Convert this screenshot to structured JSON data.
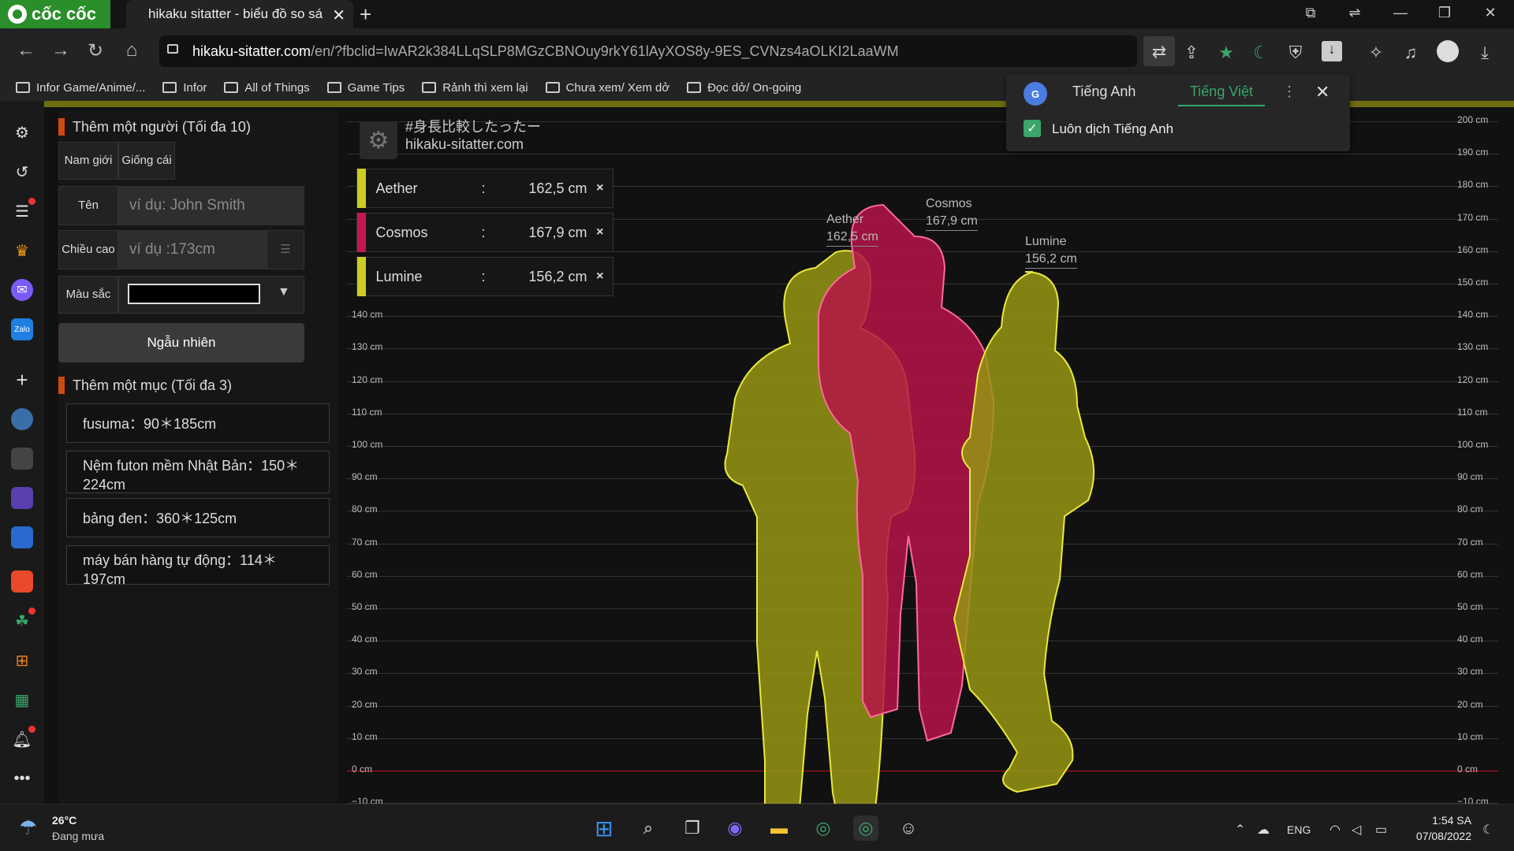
{
  "browser": {
    "brand": "cốc cốc",
    "tab_title": "hikaku sitatter - biểu đồ so sá",
    "url_host": "hikaku-sitatter.com",
    "url_path": "/en/?fbclid=IwAR2k384LLqSLP8MGzCBNOuy9rkY61lAyXOS8y-9ES_CVNzs4aOLKI2LaaWM",
    "bookmarks": [
      "Infor Game/Anime/...",
      "Infor",
      "All of Things",
      "Game Tips",
      "Rảnh thì xem lại",
      "Chưa xem/ Xem dở",
      "Đọc dở/ On-going"
    ]
  },
  "translate_popup": {
    "tab_source": "Tiếng Anh",
    "tab_target": "Tiếng Việt",
    "always_translate": "Luôn dịch Tiếng Anh",
    "close": "✕",
    "more": "⋮"
  },
  "left_panel": {
    "add_person_title": "Thêm một người (Tối đa 10)",
    "gender_male": "Nam giới",
    "gender_female": "Giống cái",
    "name_label": "Tên",
    "name_placeholder": "ví dụ: John Smith",
    "height_label": "Chiều cao",
    "height_placeholder": "ví dụ :173cm",
    "color_label": "Màu sắc",
    "random_button": "Ngẫu nhiên",
    "add_item_title": "Thêm một mục (Tối đa 3)",
    "items": [
      "fusuma：90＊185cm",
      "Nệm futon mềm Nhật Bản：150＊224cm",
      "bảng đen：360＊125cm",
      "máy bán hàng tự động：114＊197cm"
    ]
  },
  "chart_data": {
    "type": "bar",
    "watermark_title": "#身長比較したったー",
    "watermark_site": "hikaku-sitatter.com",
    "ylabels": [
      "200 cm",
      "190 cm",
      "180 cm",
      "170 cm",
      "160 cm",
      "150 cm",
      "140 cm",
      "130 cm",
      "120 cm",
      "110 cm",
      "100 cm",
      "90 cm",
      "80 cm",
      "70 cm",
      "60 cm",
      "50 cm",
      "40 cm",
      "30 cm",
      "20 cm",
      "10 cm",
      "0 cm",
      "−10 cm"
    ],
    "ylim": [
      -10,
      200
    ],
    "series": [
      {
        "name": "Aether",
        "value": 162.5,
        "value_label": "162,5 cm",
        "color": "#cccc22"
      },
      {
        "name": "Cosmos",
        "value": 167.9,
        "value_label": "167,9 cm",
        "color": "#c2184f"
      },
      {
        "name": "Lumine",
        "value": 156.2,
        "value_label": "156,2 cm",
        "color": "#cccc22"
      }
    ],
    "separator": ":",
    "remove_symbol": "×"
  },
  "taskbar": {
    "temperature": "26°C",
    "weather": "Đang mưa",
    "lang": "ENG",
    "time": "1:54 SA",
    "date": "07/08/2022"
  }
}
